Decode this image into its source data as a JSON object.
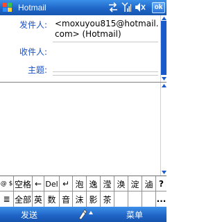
{
  "titlebar": {
    "title": "Hotmail",
    "ok_label": "ok",
    "icons": [
      "windows-flag-icon",
      "sync-arrows-icon",
      "signal-bars-icon",
      "speaker-icon"
    ]
  },
  "fields": {
    "to_label": "发件人:",
    "to_value": "<moxuyou815@hotmail.com> (Hotmail)",
    "cc_label": "收件人:",
    "subject_label": "主题:"
  },
  "ime": {
    "row1": [
      "@ $",
      "空格",
      "←",
      "Del",
      "↵",
      "泡",
      "逸",
      "滢",
      "涣",
      "淀",
      "滷",
      "?"
    ],
    "row2": [
      "≣",
      "全部",
      "英",
      "数",
      "音",
      "沫",
      "影",
      "茶",
      "",
      "",
      "",
      "..."
    ]
  },
  "menubar": {
    "left_label": "发送",
    "right_label": "菜单"
  },
  "colors": {
    "bar_blue": "#1f66c7",
    "label_blue": "#1a4fc4",
    "scroll_thumb": "#1a5ac9"
  }
}
